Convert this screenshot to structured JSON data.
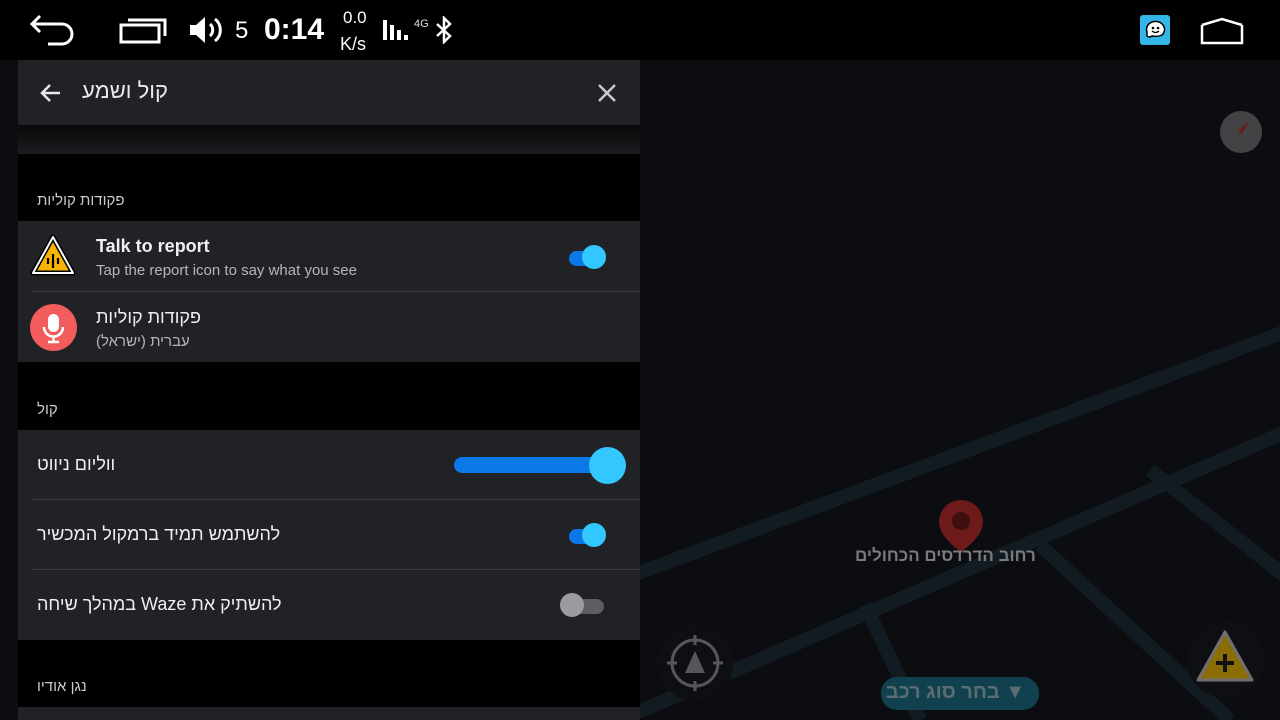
{
  "statusbar": {
    "volume_level": "5",
    "time": "0:14",
    "net_speed_value": "0.0",
    "net_speed_unit": "K/s",
    "network_type": "4G",
    "icons": [
      "back-icon",
      "recent-apps-icon",
      "volume-icon",
      "signal-icon",
      "bluetooth-icon",
      "waze-app-icon",
      "home-icon"
    ]
  },
  "panel": {
    "title": "קול ושמע",
    "sections": [
      {
        "label": "פקודות קוליות",
        "items": [
          {
            "title": "Talk to report",
            "subtitle": "Tap the report icon to say what you see",
            "icon": "report-triangle-icon",
            "toggle": true
          },
          {
            "title": "פקודות קוליות",
            "subtitle": "עברית (ישראל)",
            "icon": "microphone-icon"
          }
        ]
      },
      {
        "label": "קול",
        "items": [
          {
            "title": "ווליום ניווט",
            "slider_value_percent": 100
          },
          {
            "title": "להשתמש תמיד ברמקול המכשיר",
            "toggle": true
          },
          {
            "title": "להשתיק את Waze במהלך שיחה",
            "toggle": false
          }
        ]
      },
      {
        "label": "נגן אודיו",
        "items": []
      }
    ]
  },
  "map": {
    "street_label": "רחוב הדרדסים הכחולים",
    "vehicle_button_label": "בחר סוג רכב",
    "colors": {
      "accent_blue": "#33c7ff",
      "toggle_track_blue": "#0a78e6",
      "pin_red": "#6e1a1a",
      "report_yellow": "#8a6d05"
    }
  }
}
